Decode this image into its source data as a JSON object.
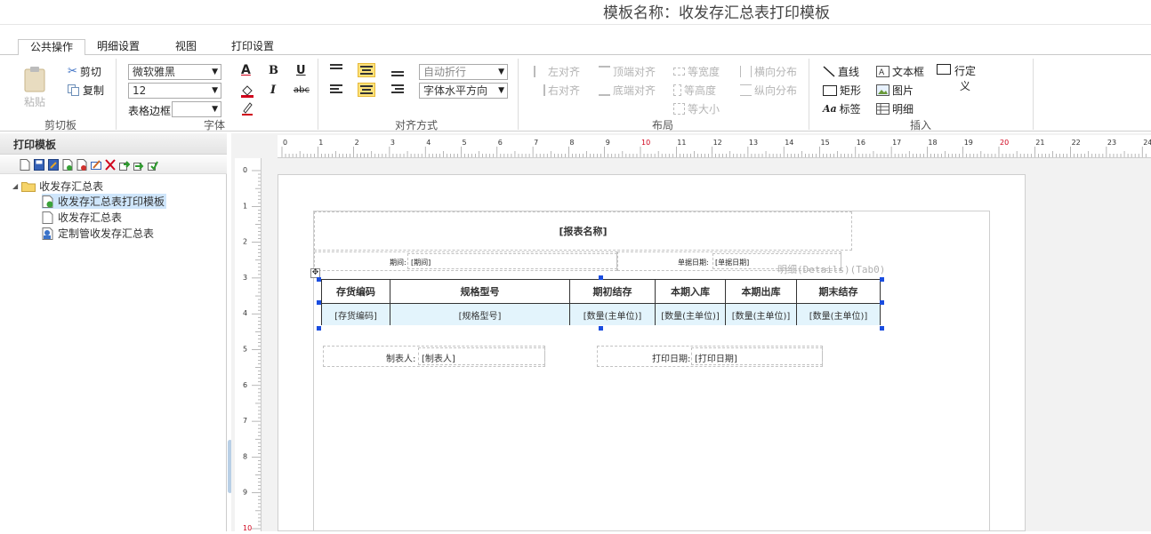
{
  "title": "模板名称：收发存汇总表打印模板",
  "tabs": [
    "公共操作",
    "明细设置",
    "视图",
    "打印设置"
  ],
  "clipboard": {
    "paste": "粘贴",
    "cut": "剪切",
    "copy": "复制",
    "group": "剪切板"
  },
  "font": {
    "family": "微软雅黑",
    "size": "12",
    "border_label": "表格边框",
    "border_value": "",
    "group": "字体",
    "bold": "B",
    "italic": "I",
    "underline": "U",
    "strike": "abc",
    "color_letter": "A"
  },
  "align": {
    "wrap": "自动折行",
    "direction": "字体水平方向",
    "group": "对齐方式"
  },
  "layout": {
    "left": "左对齐",
    "right": "右对齐",
    "top": "顶端对齐",
    "bottom": "底端对齐",
    "eq_width": "等宽度",
    "eq_height": "等高度",
    "eq_size": "等大小",
    "h_dist": "横向分布",
    "v_dist": "纵向分布",
    "group": "布局"
  },
  "insert": {
    "line": "直线",
    "rect": "矩形",
    "label": "标签",
    "textbox": "文本框",
    "image": "图片",
    "detail": "明细",
    "row_def": "行定义",
    "group": "插入"
  },
  "panel": {
    "title": "打印模板",
    "tree": {
      "root": "收发存汇总表",
      "children": [
        "收发存汇总表打印模板",
        "收发存汇总表",
        "定制管收发存汇总表"
      ]
    }
  },
  "ruler": {
    "top": [
      "0",
      "1",
      "2",
      "3",
      "4",
      "5",
      "6",
      "7",
      "8",
      "9",
      "10",
      "11",
      "12",
      "13",
      "14",
      "15",
      "16",
      "17",
      "18",
      "19",
      "20",
      "21",
      "22",
      "23",
      "24"
    ],
    "left": [
      "0",
      "1",
      "2",
      "3",
      "4",
      "5",
      "6",
      "7",
      "8",
      "9",
      "10"
    ]
  },
  "report": {
    "title": "[报表名称]",
    "period_label": "期间:",
    "period_value": "[期间]",
    "date_label": "单据日期:",
    "date_value": "[单据日期]",
    "detail_tag": "明细(Details)(Tab0)",
    "headers": [
      "存货编码",
      "规格型号",
      "期初结存",
      "本期入库",
      "本期出库",
      "期末结存"
    ],
    "row": [
      "[存货编码]",
      "[规格型号]",
      "[数量(主单位)]",
      "[数量(主单位)]",
      "[数量(主单位)]",
      "[数量(主单位)]"
    ],
    "maker_label": "制表人:",
    "maker_value": "[制表人]",
    "print_date_label": "打印日期:",
    "print_date_value": "[打印日期]"
  },
  "colors": {
    "accent_red": "#d0021b",
    "selection_blue": "#1a4de0",
    "row_highlight": "#e3f4fc"
  }
}
